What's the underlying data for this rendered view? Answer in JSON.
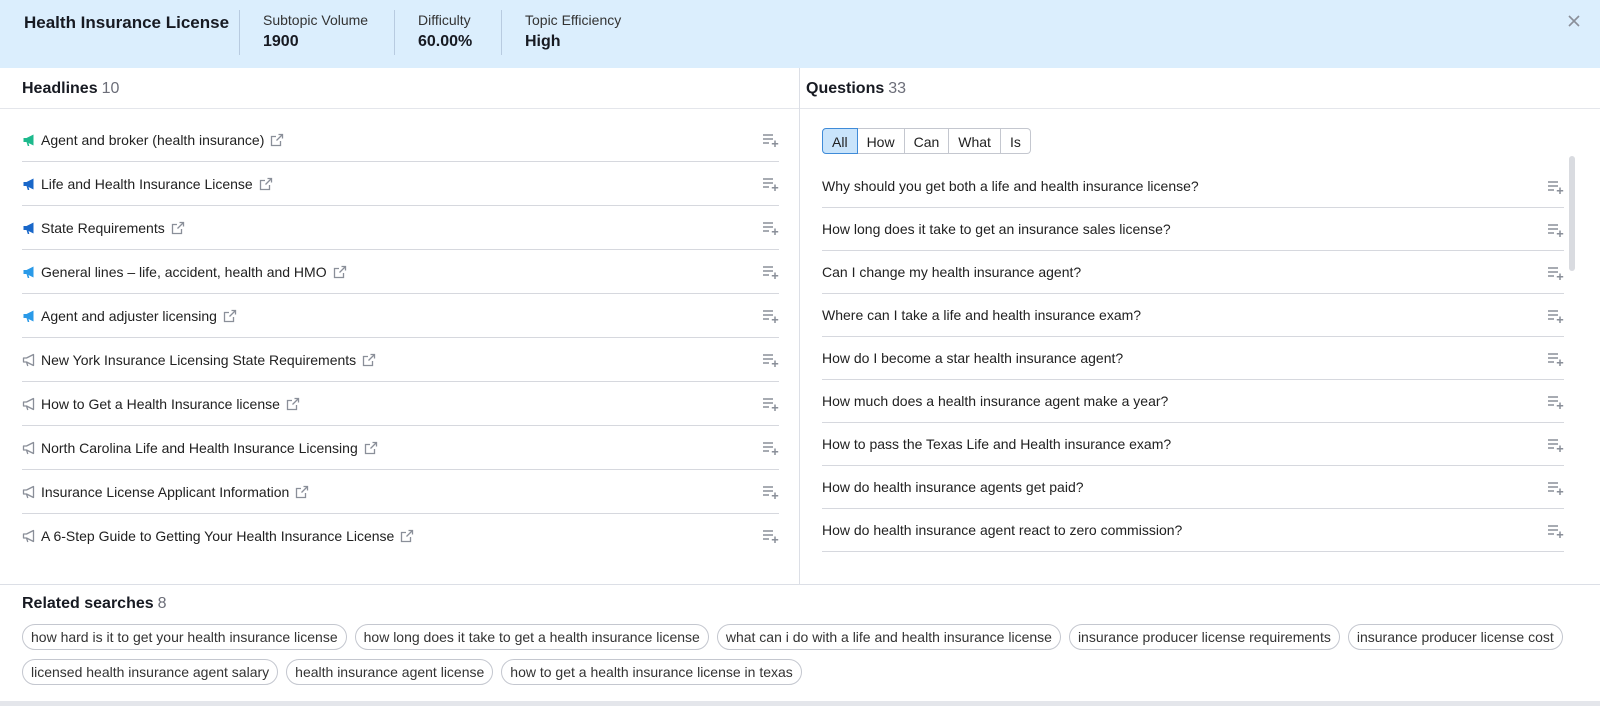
{
  "header": {
    "title": "Health Insurance License",
    "metrics": [
      {
        "label": "Subtopic Volume",
        "value": "1900"
      },
      {
        "label": "Difficulty",
        "value": "60.00%"
      },
      {
        "label": "Topic Efficiency",
        "value": "High"
      }
    ],
    "close_icon": "close-icon"
  },
  "headlines": {
    "title": "Headlines",
    "count": "10",
    "items": [
      {
        "text": "Agent and broker (health insurance)",
        "level": "high",
        "color": "#1db98c"
      },
      {
        "text": "Life and Health Insurance License",
        "level": "high",
        "color": "#1967c9"
      },
      {
        "text": "State Requirements",
        "level": "high",
        "color": "#1967c9"
      },
      {
        "text": "General lines – life, accident, health and HMO",
        "level": "medium",
        "color": "#2a9ae8"
      },
      {
        "text": "Agent and adjuster licensing",
        "level": "medium",
        "color": "#2a9ae8"
      },
      {
        "text": "New York Insurance Licensing State Requirements",
        "level": "low",
        "color": "#8a8f99"
      },
      {
        "text": "How to Get a Health Insurance license",
        "level": "low",
        "color": "#8a8f99"
      },
      {
        "text": "North Carolina Life and Health Insurance Licensing",
        "level": "low",
        "color": "#8a8f99"
      },
      {
        "text": "Insurance License Applicant Information",
        "level": "low",
        "color": "#8a8f99"
      },
      {
        "text": "A 6-Step Guide to Getting Your Health Insurance License",
        "level": "low",
        "color": "#8a8f99"
      }
    ]
  },
  "questions": {
    "title": "Questions",
    "count": "33",
    "filters": [
      {
        "label": "All",
        "active": true
      },
      {
        "label": "How",
        "active": false
      },
      {
        "label": "Can",
        "active": false
      },
      {
        "label": "What",
        "active": false
      },
      {
        "label": "Is",
        "active": false
      }
    ],
    "items": [
      "Why should you get both a life and health insurance license?",
      "How long does it take to get an insurance sales license?",
      "Can I change my health insurance agent?",
      "Where can I take a life and health insurance exam?",
      "How do I become a star health insurance agent?",
      "How much does a health insurance agent make a year?",
      "How to pass the Texas Life and Health insurance exam?",
      "How do health insurance agents get paid?",
      "How do health insurance agent react to zero commission?"
    ]
  },
  "related": {
    "title": "Related searches",
    "count": "8",
    "chips": [
      "how hard is it to get your health insurance license",
      "how long does it take to get a health insurance license",
      "what can i do with a life and health insurance license",
      "insurance producer license requirements",
      "insurance producer license cost",
      "licensed health insurance agent salary",
      "health insurance agent license",
      "how to get a health insurance license in texas"
    ]
  },
  "colors": {
    "header_bg": "#dbeefd",
    "accent": "#3f8bd8",
    "icon_gray": "#8a8f99"
  }
}
